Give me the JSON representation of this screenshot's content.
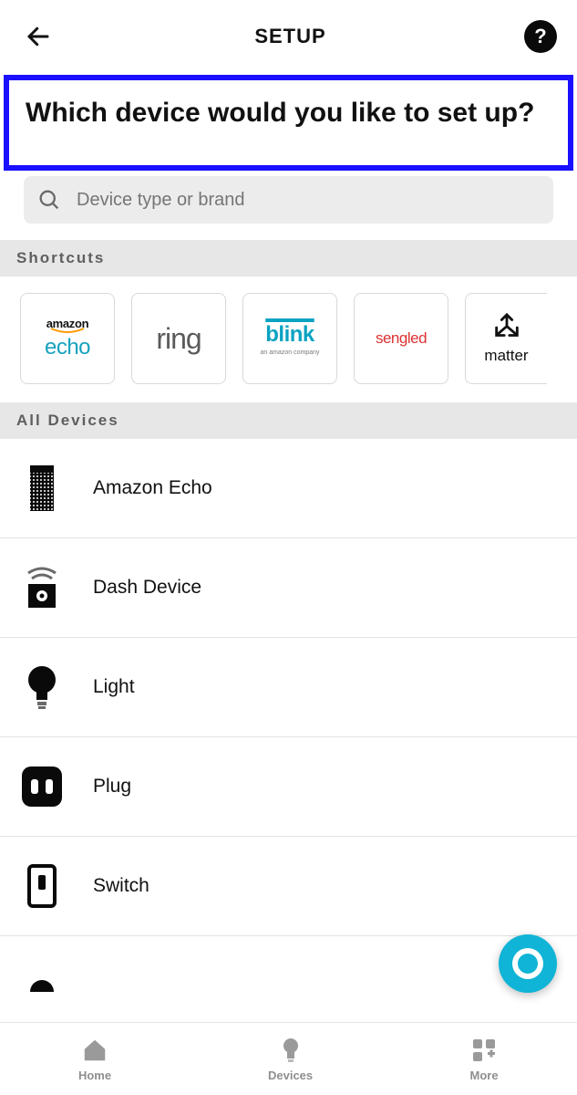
{
  "header": {
    "title": "SETUP"
  },
  "prompt": "Which device would you like to set up?",
  "search": {
    "placeholder": "Device type or brand"
  },
  "sections": {
    "shortcuts_label": "Shortcuts",
    "all_devices_label": "All Devices"
  },
  "shortcuts": [
    {
      "id": "amazon-echo",
      "line1": "amazon",
      "line2": "echo"
    },
    {
      "id": "ring",
      "label": "ring"
    },
    {
      "id": "blink",
      "label": "blink",
      "sub": "an amazon company"
    },
    {
      "id": "sengled",
      "label": "sengled"
    },
    {
      "id": "matter",
      "label": "matter"
    }
  ],
  "devices": [
    {
      "id": "amazon-echo",
      "label": "Amazon Echo"
    },
    {
      "id": "dash-device",
      "label": "Dash Device"
    },
    {
      "id": "light",
      "label": "Light"
    },
    {
      "id": "plug",
      "label": "Plug"
    },
    {
      "id": "switch",
      "label": "Switch"
    }
  ],
  "nav": {
    "home": "Home",
    "devices": "Devices",
    "more": "More"
  }
}
